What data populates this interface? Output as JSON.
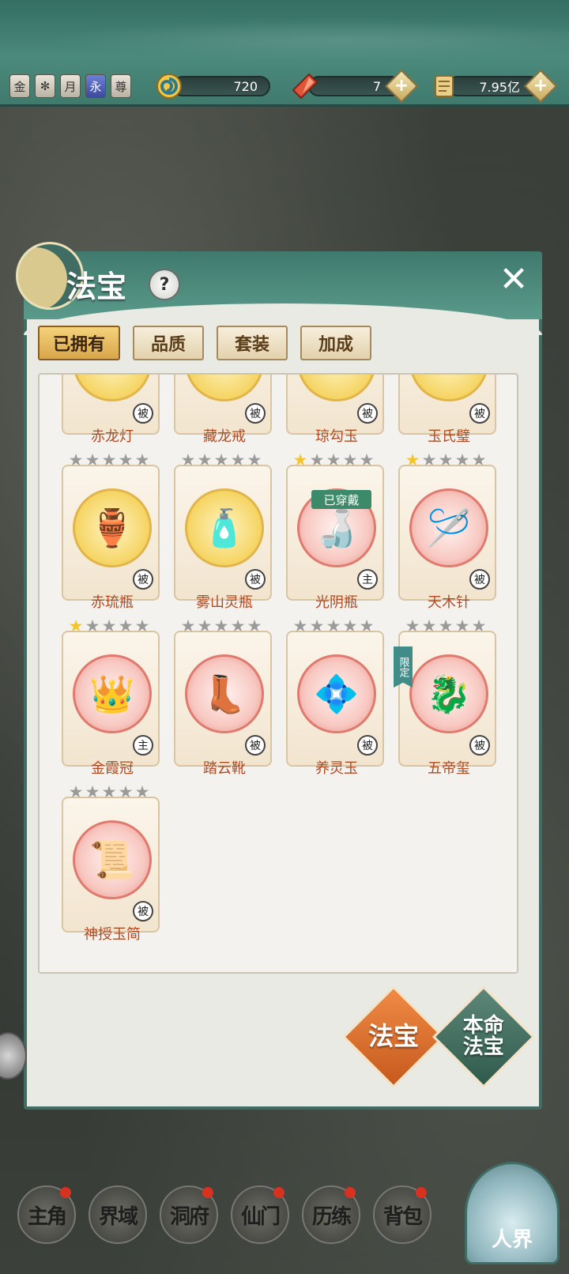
{
  "top_bar": {
    "badges": [
      "金",
      "✻",
      "月",
      "永",
      "尊"
    ],
    "resources": [
      {
        "icon": "spiral-icon",
        "value": "720"
      },
      {
        "icon": "red-crystal-icon",
        "value": "7"
      },
      {
        "icon": "scroll-icon",
        "value": "7.95亿"
      }
    ]
  },
  "panel": {
    "title": "法宝",
    "help": "?",
    "close": "✕",
    "tabs": [
      "已拥有",
      "品质",
      "套装",
      "加成"
    ],
    "items_partial": [
      {
        "name": "赤龙灯",
        "tag": "被"
      },
      {
        "name": "藏龙戒",
        "tag": "被"
      },
      {
        "name": "琼勾玉",
        "tag": "被"
      },
      {
        "name": "玉氏璧",
        "tag": "被"
      }
    ],
    "items": [
      {
        "name": "赤琉瓶",
        "stars": 0,
        "tag": "被",
        "orb": "gold",
        "icon": "🏺"
      },
      {
        "name": "雾山灵瓶",
        "stars": 0,
        "tag": "被",
        "orb": "gold",
        "icon": "🧴"
      },
      {
        "name": "光阴瓶",
        "stars": 1,
        "tag": "主",
        "orb": "red",
        "icon": "🍶",
        "equipped": "已穿戴"
      },
      {
        "name": "天木针",
        "stars": 1,
        "tag": "被",
        "orb": "red",
        "icon": "🪡"
      },
      {
        "name": "金霞冠",
        "stars": 1,
        "tag": "主",
        "orb": "red",
        "icon": "👑"
      },
      {
        "name": "踏云靴",
        "stars": 0,
        "tag": "被",
        "orb": "red",
        "icon": "👢"
      },
      {
        "name": "养灵玉",
        "stars": 0,
        "tag": "被",
        "orb": "red",
        "icon": "💠"
      },
      {
        "name": "五帝玺",
        "stars": 0,
        "tag": "被",
        "orb": "red",
        "icon": "🐉",
        "limited": "限定"
      },
      {
        "name": "神授玉简",
        "stars": 0,
        "tag": "被",
        "orb": "red",
        "icon": "📜"
      }
    ],
    "buttons": {
      "fabao": "法宝",
      "benming": "本命\n法宝"
    }
  },
  "bottom_nav": {
    "items": [
      {
        "label": "主角",
        "dot": true
      },
      {
        "label": "界域",
        "dot": false
      },
      {
        "label": "洞府",
        "dot": true
      },
      {
        "label": "仙门",
        "dot": true
      },
      {
        "label": "历练",
        "dot": true
      },
      {
        "label": "背包",
        "dot": true
      }
    ],
    "realm": "人界"
  },
  "colors": {
    "accent": "#3f7a6d",
    "item_name": "#b04a22",
    "star_on": "#f4c52b"
  }
}
